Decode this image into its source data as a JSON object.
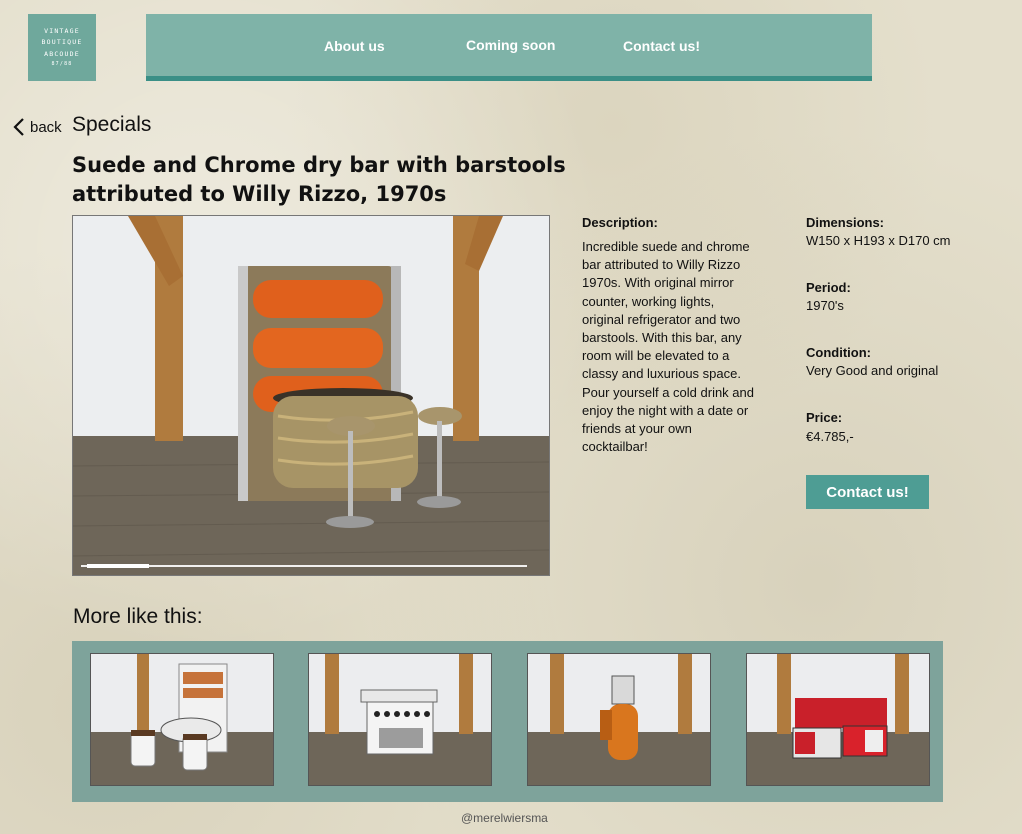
{
  "logo": {
    "line1": "VINTAGE",
    "line2": "BOUTIQUE",
    "line3": "ABCOUDE",
    "line4": "87/88"
  },
  "nav": {
    "items": [
      "About us",
      "Coming soon",
      "Contact us!"
    ]
  },
  "back_label": "back",
  "section_title": "Specials",
  "product": {
    "title": "Suede and Chrome dry bar with barstools attributed to Willy Rizzo, 1970s",
    "description_label": "Description:",
    "description": "Incredible suede and chrome bar attributed to Willy Rizzo 1970s. With original mirror counter, working lights, original refrigerator and two barstools. With this bar, any room will be elevated to a classy and luxurious space. Pour yourself a cold drink and enjoy the night with a date or friends at your own cocktailbar!",
    "dimensions_label": "Dimensions:",
    "dimensions": "W150 x H193 x D170 cm",
    "period_label": "Period:",
    "period": "1970's",
    "condition_label": "Condition:",
    "condition": "Very Good and original",
    "price_label": "Price:",
    "price": "€4.785,-",
    "contact_button": "Contact us!",
    "gallery_progress": 0.14
  },
  "more": {
    "title": "More like this:",
    "thumbnails": [
      "white-bar-cabinet",
      "white-dry-bar",
      "orange-vanity",
      "red-corner-bar"
    ]
  },
  "credit": "@merelwiersma",
  "colors": {
    "nav_bg": "#7fb3a8",
    "nav_border": "#3a8f86",
    "button": "#4e9d94",
    "panel": "#7ea39b",
    "logo": "#6fa89c"
  }
}
